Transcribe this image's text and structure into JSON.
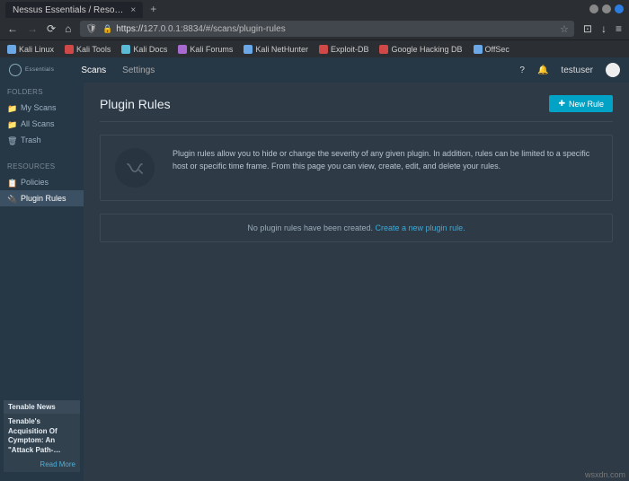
{
  "window": {
    "tab_title": "Nessus Essentials / Reso…",
    "controls": {
      "min": "#888",
      "max": "#888",
      "close": "#2b7de0"
    }
  },
  "browser": {
    "url": "https://127.0.0.1:8834/#/scans/plugin-rules",
    "url_display": "127.0.0.1:8834/#/scans/plugin-rules",
    "bookmarks": [
      {
        "label": "Kali Linux",
        "color": "#6aa8e8"
      },
      {
        "label": "Kali Tools",
        "color": "#d04848"
      },
      {
        "label": "Kali Docs",
        "color": "#5bbad5"
      },
      {
        "label": "Kali Forums",
        "color": "#a86ad0"
      },
      {
        "label": "Kali NetHunter",
        "color": "#6aa8e8"
      },
      {
        "label": "Exploit-DB",
        "color": "#d04848"
      },
      {
        "label": "Google Hacking DB",
        "color": "#d04848"
      },
      {
        "label": "OffSec",
        "color": "#6aa8e8"
      }
    ]
  },
  "nessus": {
    "brand": "nessus",
    "edition": "Essentials",
    "nav": {
      "scans": "Scans",
      "settings": "Settings"
    },
    "user": "testuser"
  },
  "sidebar": {
    "folders_label": "FOLDERS",
    "folders": [
      {
        "label": "My Scans"
      },
      {
        "label": "All Scans"
      },
      {
        "label": "Trash"
      }
    ],
    "resources_label": "RESOURCES",
    "resources": [
      {
        "label": "Policies",
        "active": false
      },
      {
        "label": "Plugin Rules",
        "active": true
      }
    ]
  },
  "page": {
    "title": "Plugin Rules",
    "new_rule": "New Rule",
    "info": "Plugin rules allow you to hide or change the severity of any given plugin. In addition, rules can be limited to a specific host or specific time frame. From this page you can view, create, edit, and delete your rules.",
    "empty_prefix": "No plugin rules have been created. ",
    "empty_link": "Create a new plugin rule."
  },
  "news": {
    "header": "Tenable News",
    "title": "Tenable's Acquisition Of Cymptom: An \"Attack Path-…",
    "more": "Read More"
  },
  "watermark": "wsxdn.com"
}
